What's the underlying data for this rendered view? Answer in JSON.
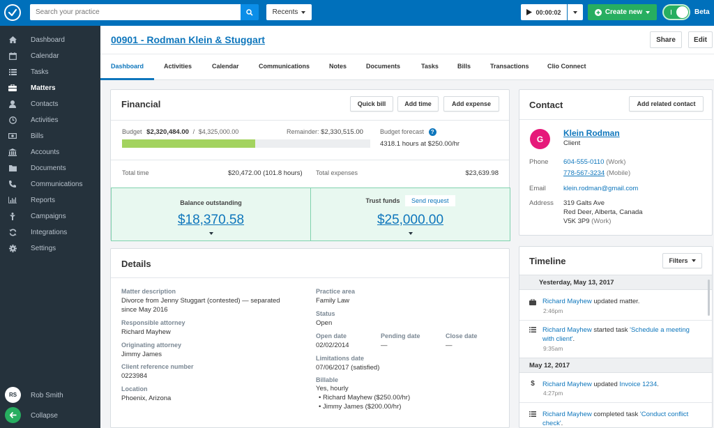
{
  "topbar": {
    "search_placeholder": "Search your practice",
    "recents_label": "Recents",
    "timer_value": "00:00:02",
    "create_new_label": "Create new",
    "beta_label": "Beta",
    "beta_enabled": true,
    "brand_color": "#0070bb",
    "create_color": "#27ae60"
  },
  "sidebar": {
    "items": [
      {
        "label": "Dashboard",
        "icon": "home-icon"
      },
      {
        "label": "Calendar",
        "icon": "calendar-icon"
      },
      {
        "label": "Tasks",
        "icon": "list-icon"
      },
      {
        "label": "Matters",
        "icon": "briefcase-icon",
        "active": true
      },
      {
        "label": "Contacts",
        "icon": "person-icon"
      },
      {
        "label": "Activities",
        "icon": "clock-icon"
      },
      {
        "label": "Bills",
        "icon": "money-icon"
      },
      {
        "label": "Accounts",
        "icon": "bank-icon"
      },
      {
        "label": "Documents",
        "icon": "folder-icon"
      },
      {
        "label": "Communications",
        "icon": "phone-icon"
      },
      {
        "label": "Reports",
        "icon": "bar-chart-icon"
      },
      {
        "label": "Campaigns",
        "icon": "campaign-icon"
      },
      {
        "label": "Integrations",
        "icon": "sync-icon"
      },
      {
        "label": "Settings",
        "icon": "gear-icon"
      }
    ],
    "user_initials": "RS",
    "user_name": "Rob Smith",
    "collapse_label": "Collapse"
  },
  "header": {
    "matter_title": "00901 - Rodman Klein & Stuggart",
    "share_label": "Share",
    "edit_label": "Edit",
    "tabs": [
      {
        "label": "Dashboard",
        "active": true
      },
      {
        "label": "Activities"
      },
      {
        "label": "Calendar"
      },
      {
        "label": "Communications"
      },
      {
        "label": "Notes"
      },
      {
        "label": "Documents"
      },
      {
        "label": "Tasks"
      },
      {
        "label": "Bills"
      },
      {
        "label": "Transactions"
      },
      {
        "label": "Clio Connect"
      }
    ]
  },
  "financial": {
    "title": "Financial",
    "quick_bill_label": "Quick bill",
    "add_time_label": "Add time",
    "add_expense_label": "Add expense",
    "budget_label": "Budget",
    "budget_used": "$2,320,484.00",
    "budget_sep": "/",
    "budget_total": "$4,325,000.00",
    "budget_progress_percent": 53.6,
    "remainder_label": "Remainder:",
    "remainder_value": "$2,330,515.00",
    "forecast_label": "Budget forecast",
    "forecast_value": "4318.1 hours at $250.00/hr",
    "total_time_label": "Total time",
    "total_time_value": "$20,472.00 (101.8 hours)",
    "total_expenses_label": "Total expenses",
    "total_expenses_value": "$23,639.98",
    "balance_label": "Balance outstanding",
    "balance_value": "$18,370.58",
    "trust_label": "Trust funds",
    "send_request_label": "Send request",
    "trust_value": "$25,000.00"
  },
  "details": {
    "title": "Details",
    "left": [
      {
        "label": "Matter description",
        "value_lines": [
          "Divorce from Jenny Stuggart (contested) — separated",
          "since May 2016"
        ]
      },
      {
        "label": "Responsible attorney",
        "value_lines": [
          "Richard Mayhew"
        ]
      },
      {
        "label": "Originating attorney",
        "value_lines": [
          "Jimmy James"
        ]
      },
      {
        "label": "Client reference number",
        "value_lines": [
          "0223984"
        ]
      },
      {
        "label": "Location",
        "value_lines": [
          "Phoenix, Arizona"
        ]
      }
    ],
    "practice_area_label": "Practice area",
    "practice_area_value": "Family Law",
    "status_label": "Status",
    "status_value": "Open",
    "open_date_label": "Open date",
    "open_date_value": "02/02/2014",
    "pending_date_label": "Pending date",
    "pending_date_value": "—",
    "close_date_label": "Close date",
    "close_date_value": "—",
    "limitations_label": "Limitations date",
    "limitations_value": "07/06/2017 (satisfied)",
    "billable_label": "Billable",
    "billable_value": "Yes, hourly",
    "billable_rates": [
      "• Richard Mayhew ($250.00/hr)",
      "• Jimmy James ($200.00/hr)"
    ]
  },
  "contact": {
    "title": "Contact",
    "add_related_label": "Add related contact",
    "avatar_initial": "G",
    "avatar_color": "#e6197a",
    "name": "Klein Rodman",
    "role": "Client",
    "phone_label": "Phone",
    "phones": [
      {
        "number": "604-555-0110",
        "type": "(Work)"
      },
      {
        "number": "778-567-3234",
        "type": "(Mobile)"
      }
    ],
    "email_label": "Email",
    "email": "klein.rodman@gmail.com",
    "address_label": "Address",
    "address_line1": "319 Galts Ave",
    "address_line2": "Red Deer, Alberta, Canada",
    "address_postal": "V5K 3P9",
    "address_type": "(Work)"
  },
  "timeline": {
    "title": "Timeline",
    "filters_label": "Filters",
    "groups": [
      {
        "date": "Yesterday, May 13, 2017",
        "entries": [
          {
            "icon": "briefcase-icon",
            "actor": "Richard Mayhew",
            "action": " updated matter.",
            "target": "",
            "suffix": "",
            "time": "2:46pm"
          },
          {
            "icon": "list-icon",
            "actor": "Richard Mayhew",
            "action": " started task ",
            "target": "'Schedule a meeting",
            "target2": "with client'",
            "suffix": ".",
            "time": "9:35am"
          }
        ]
      },
      {
        "date": "May 12, 2017",
        "entries": [
          {
            "icon": "dollar-icon",
            "actor": "Richard Mayhew",
            "action": " updated ",
            "target": "Invoice 1234",
            "suffix": ".",
            "time": "4:27pm"
          },
          {
            "icon": "list-icon",
            "actor": "Richard Mayhew",
            "action": " completed task ",
            "target": "'Conduct conflict",
            "target2": "check'",
            "suffix": "."
          }
        ]
      }
    ]
  }
}
